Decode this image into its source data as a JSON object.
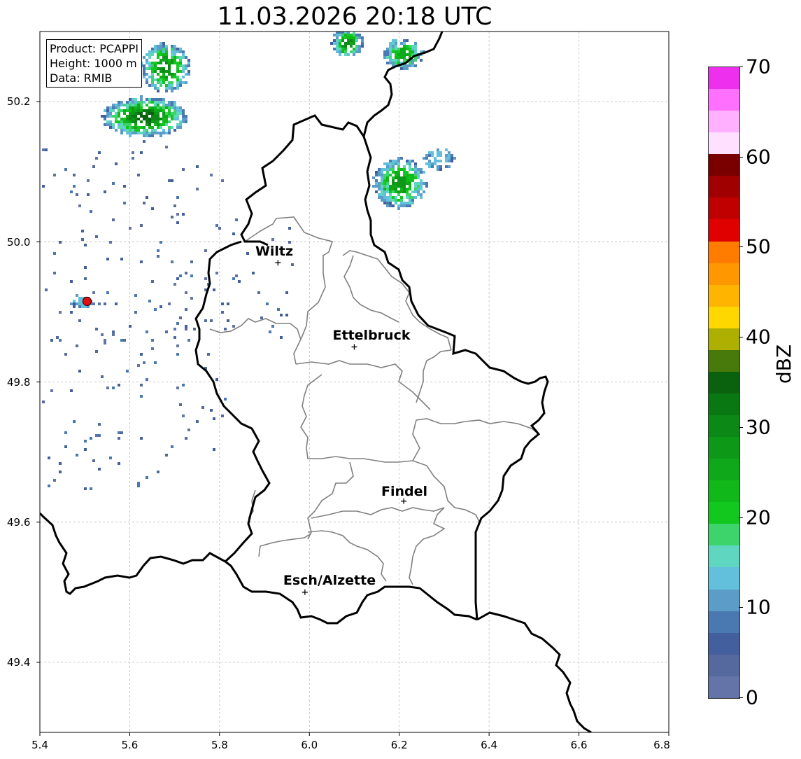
{
  "title": "11.03.2026 20:18 UTC",
  "info_box": {
    "product": "Product: PCAPPI",
    "height": "Height: 1000 m",
    "data": "Data: RMIB"
  },
  "axes": {
    "x_ticks": [
      "5.4",
      "5.6",
      "5.8",
      "6.0",
      "6.2",
      "6.4",
      "6.6",
      "6.8"
    ],
    "y_ticks": [
      "50.2",
      "50.0",
      "49.8",
      "49.6",
      "49.4"
    ],
    "xlim": [
      5.4,
      6.8
    ],
    "ylim": [
      49.3,
      50.3
    ],
    "grid": true
  },
  "cities": [
    {
      "name": "Wiltz",
      "lon": 5.93,
      "lat": 49.97
    },
    {
      "name": "Ettelbruck",
      "lon": 6.1,
      "lat": 49.85
    },
    {
      "name": "Findel",
      "lon": 6.21,
      "lat": 49.63
    },
    {
      "name": "Esch/Alzette",
      "lon": 5.99,
      "lat": 49.5
    }
  ],
  "radar_site": {
    "lon": 5.505,
    "lat": 49.915,
    "color": "#e01010"
  },
  "colorbar": {
    "label": "dBZ",
    "ticks": [
      "0",
      "10",
      "20",
      "30",
      "40",
      "50",
      "60",
      "70"
    ],
    "colors": [
      "#6473a8",
      "#56699e",
      "#445f9e",
      "#4a78b0",
      "#5b9cc8",
      "#63c0dd",
      "#5ed6c0",
      "#3dd46b",
      "#12c81e",
      "#10b81a",
      "#0fa81a",
      "#0e9818",
      "#0c8816",
      "#0a7812",
      "#0a620e",
      "#477a0a",
      "#adb000",
      "#ffd700",
      "#ffb400",
      "#ff9800",
      "#ff7c00",
      "#e00000",
      "#c00000",
      "#a00000",
      "#7a0000",
      "#ffe0ff",
      "#ffb0ff",
      "#ff70ff",
      "#ee30ee"
    ]
  }
}
